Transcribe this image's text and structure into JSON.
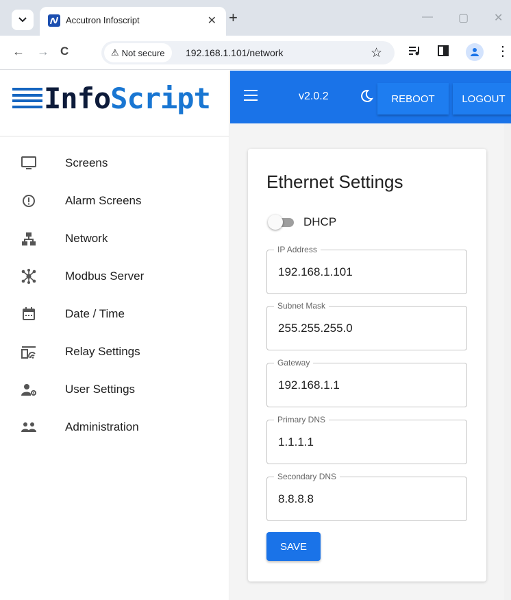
{
  "browser": {
    "tab_title": "Accutron Infoscript",
    "tab_close": "✕",
    "new_tab": "+",
    "back": "←",
    "forward": "→",
    "reload": "C",
    "security_label": "Not secure",
    "security_icon": "⚠",
    "url": "192.168.1.101/network",
    "bookmark_icon": "☆",
    "menu_icon": "⋮",
    "minimize": "—",
    "maximize": "▢",
    "close": "✕"
  },
  "logo": {
    "part1": "Info",
    "part2": "Script"
  },
  "sidebar": {
    "items": [
      {
        "label": "Screens",
        "icon": "monitor-icon"
      },
      {
        "label": "Alarm Screens",
        "icon": "alert-circle-icon"
      },
      {
        "label": "Network",
        "icon": "network-icon"
      },
      {
        "label": "Modbus Server",
        "icon": "hub-icon"
      },
      {
        "label": "Date / Time",
        "icon": "calendar-icon"
      },
      {
        "label": "Relay Settings",
        "icon": "relay-icon"
      },
      {
        "label": "User Settings",
        "icon": "user-settings-icon"
      },
      {
        "label": "Administration",
        "icon": "people-icon"
      }
    ]
  },
  "appbar": {
    "version": "v2.0.2",
    "reboot_label": "REBOOT",
    "logout_label": "LOGOUT",
    "color": "#1a73e8"
  },
  "card": {
    "title": "Ethernet Settings",
    "dhcp_label": "DHCP",
    "dhcp_enabled": false,
    "fields": [
      {
        "label": "IP Address",
        "value": "192.168.1.101"
      },
      {
        "label": "Subnet Mask",
        "value": "255.255.255.0"
      },
      {
        "label": "Gateway",
        "value": "192.168.1.1"
      },
      {
        "label": "Primary DNS",
        "value": "1.1.1.1"
      },
      {
        "label": "Secondary DNS",
        "value": "8.8.8.8"
      }
    ],
    "save_label": "SAVE"
  }
}
